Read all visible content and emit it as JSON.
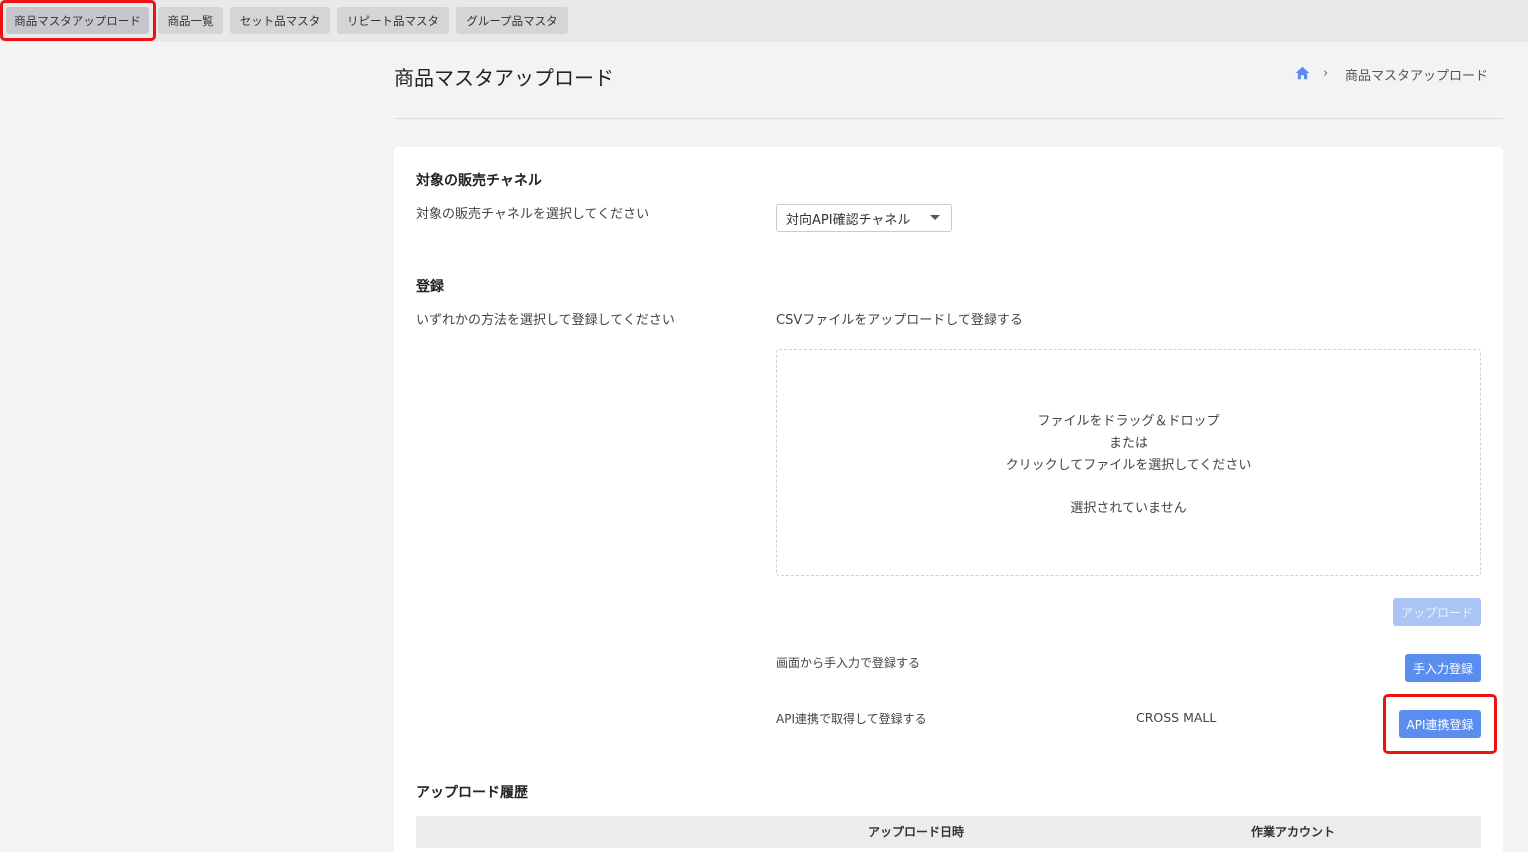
{
  "tabs": [
    {
      "label": "商品マスタアップロード",
      "active": true
    },
    {
      "label": "商品一覧",
      "active": false
    },
    {
      "label": "セット品マスタ",
      "active": false
    },
    {
      "label": "リピート品マスタ",
      "active": false
    },
    {
      "label": "グループ品マスタ",
      "active": false
    }
  ],
  "page": {
    "title": "商品マスタアップロード"
  },
  "breadcrumb": {
    "icon": "home-icon",
    "separator": "›",
    "current": "商品マスタアップロード"
  },
  "channel": {
    "heading": "対象の販売チャネル",
    "description": "対象の販売チャネルを選択してください",
    "selected": "対向API確認チャネル"
  },
  "register": {
    "heading": "登録",
    "description": "いずれかの方法を選択して登録してください",
    "csv_label": "CSVファイルをアップロードして登録する",
    "dropzone": {
      "line1": "ファイルをドラッグ＆ドロップ",
      "line2": "または",
      "line3": "クリックしてファイルを選択してください",
      "status": "選択されていません"
    },
    "upload_button": "アップロード",
    "manual_label": "画面から手入力で登録する",
    "manual_button": "手入力登録",
    "api_label": "API連携で取得して登録する",
    "api_source": "CROSS MALL",
    "api_button": "API連携登録"
  },
  "history": {
    "heading": "アップロード履歴",
    "columns": [
      "アップロード日時",
      "作業アカウント"
    ]
  },
  "colors": {
    "primary": "#5b8def",
    "primary_disabled": "#a9c4f5",
    "highlight": "#ee1111"
  }
}
